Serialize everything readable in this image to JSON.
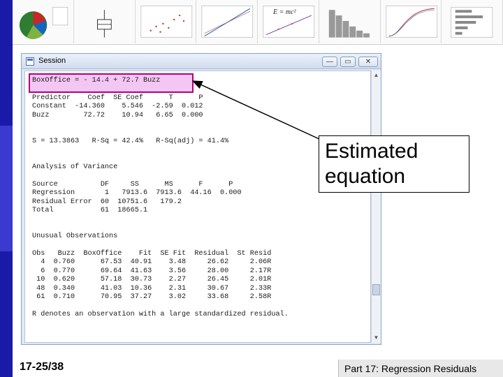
{
  "window": {
    "title": "Session",
    "min_label": "—",
    "max_label": "▭",
    "close_label": "✕"
  },
  "session": {
    "lines": [
      "BoxOffice = - 14.4 + 72.7 Buzz",
      "",
      "Predictor    Coef  SE Coef      T      P",
      "Constant  -14.360    5.546  -2.59  0.012",
      "Buzz        72.72    10.94   6.65  0.000",
      "",
      "",
      "S = 13.3863   R-Sq = 42.4%   R-Sq(adj) = 41.4%",
      "",
      "",
      "Analysis of Variance",
      "",
      "Source          DF     SS      MS      F      P",
      "Regression       1   7913.6  7913.6  44.16  0.000",
      "Residual Error  60  10751.6   179.2",
      "Total           61  18665.1",
      "",
      "",
      "Unusual Observations",
      "",
      "Obs   Buzz  BoxOffice    Fit  SE Fit  Residual  St Resid",
      "  4  0.760      67.53  40.91    3.48     26.62     2.06R",
      "  6  0.770      69.64  41.63    3.56     28.00     2.17R",
      " 10  0.620      57.18  30.73    2.27     26.45     2.01R",
      " 48  0.340      41.03  10.36    2.31     30.67     2.33R",
      " 61  0.710      70.95  37.27    3.02     33.68     2.58R",
      "",
      "R denotes an observation with a large standardized residual."
    ]
  },
  "callout": {
    "line1": "Estimated",
    "line2": "equation"
  },
  "thumb_formula": "E = mc²",
  "slide_number": "17-25/38",
  "footer": "Part 17: Regression Residuals",
  "colors": {
    "stripe": "#1a1aa8",
    "highlight_fill": "#f4c6f4",
    "highlight_border": "#b3007a"
  }
}
